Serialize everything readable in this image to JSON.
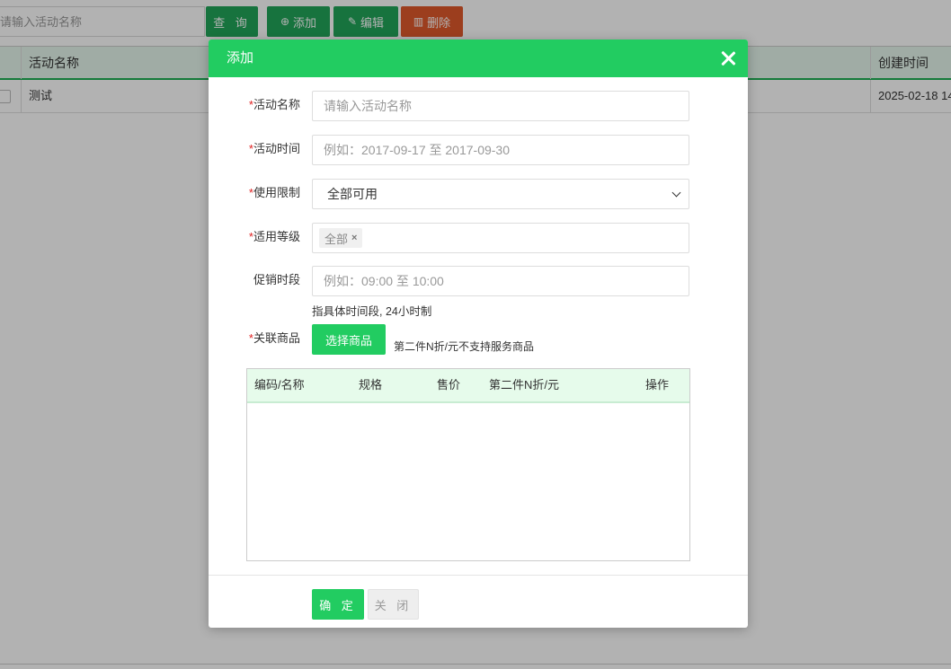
{
  "background": {
    "search": {
      "placeholder": "请输入活动名称"
    },
    "buttons": {
      "query": "查 询",
      "add": "添加",
      "add_icon": "plus-circle-icon",
      "edit": "编辑",
      "edit_icon": "edit-icon",
      "delete": "删除",
      "delete_icon": "trash-icon"
    },
    "table": {
      "columns": [
        "活动名称",
        "创建时间"
      ],
      "rows": [
        {
          "name": "测试",
          "created": "2025-02-18 14"
        }
      ]
    },
    "colors": {
      "green": "#22a55a",
      "red": "#e05a2b"
    }
  },
  "dialog": {
    "title": "添加",
    "close_icon": "close-icon",
    "required_mark": "*",
    "fields": {
      "name": {
        "label": "活动名称",
        "placeholder": "请输入活动名称"
      },
      "time": {
        "label": "活动时间",
        "placeholder": "例如：2017-09-17 至 2017-09-30"
      },
      "limit": {
        "label": "使用限制",
        "value": "全部可用"
      },
      "level": {
        "label": "适用等级",
        "tag": "全部",
        "tag_remove": "×"
      },
      "period": {
        "label": "促销时段",
        "placeholder": "例如：09:00 至 10:00",
        "hint": "指具体时间段, 24小时制"
      },
      "goods": {
        "label": "关联商品",
        "button": "选择商品",
        "hint": "第二件N折/元不支持服务商品"
      }
    },
    "goods_table": {
      "columns": [
        "编码/名称",
        "规格",
        "售价",
        "第二件N折/元",
        "操作"
      ]
    },
    "footer": {
      "ok": "确 定",
      "close": "关 闭"
    },
    "colors": {
      "header": "#22cc61",
      "table_head": "#e6fbeb"
    }
  }
}
